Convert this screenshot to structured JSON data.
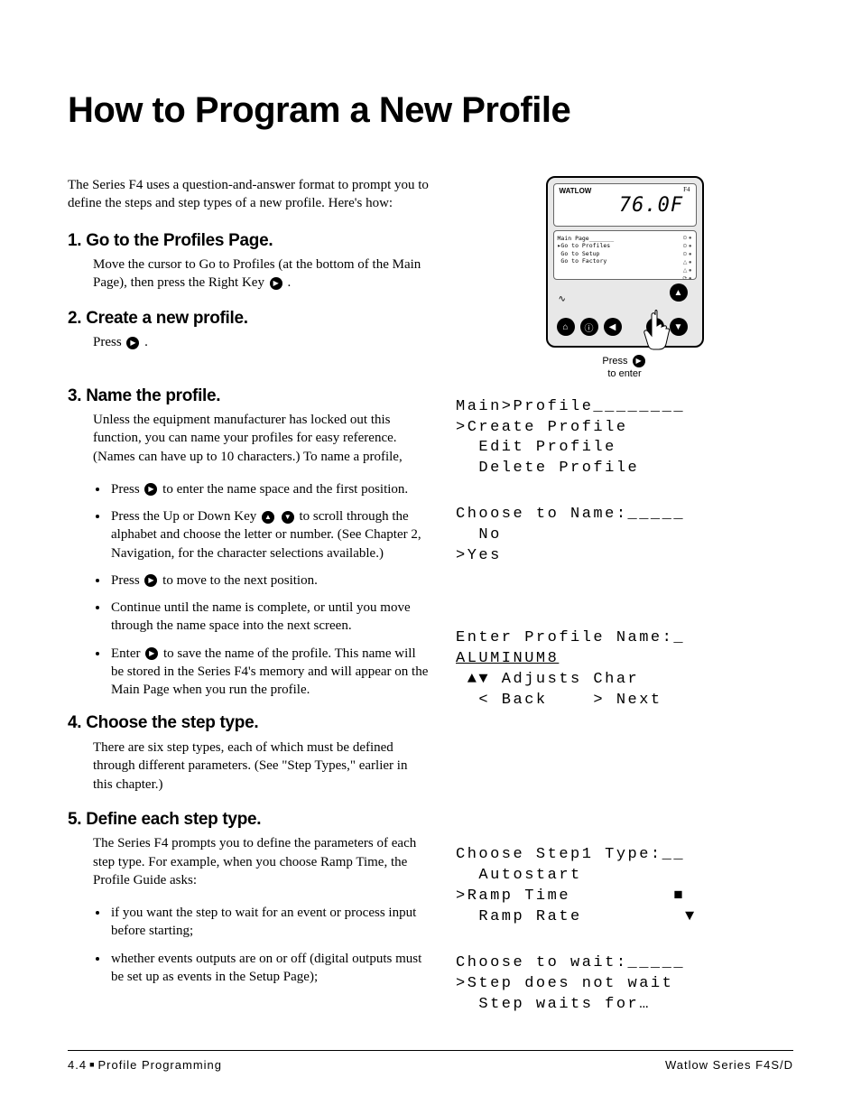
{
  "title": "How to Program a New Profile",
  "intro": "The Series F4 uses a question-and-answer format to prompt you to define the steps and step types of a new profile. Here's how:",
  "sections": [
    {
      "heading": "1. Go to the Profiles Page.",
      "body": "Move the cursor to Go to Profiles (at the bottom of the Main Page), then press the Right Key",
      "body_suffix": "."
    },
    {
      "heading": "2. Create a new profile.",
      "body": "Press",
      "body_suffix": "."
    },
    {
      "heading": "3. Name the profile.",
      "body": "Unless the equipment manufacturer has locked out this function, you can name your profiles for easy reference. (Names can have up to 10 characters.) To name a profile,",
      "bullets": [
        {
          "pre": "Press ",
          "icon": "▶",
          "post": " to enter the name space and the first position."
        },
        {
          "pre": "Press the Up or Down Key ",
          "icon": "▲",
          "icon2": "▼",
          "post": " to scroll through the alphabet and choose the letter or number. (See Chapter 2, Navigation, for the character selections available.)"
        },
        {
          "pre": "Press ",
          "icon": "▶",
          "post": " to move to the next position."
        },
        {
          "pre": "",
          "post": "Continue until the name is complete, or until you move through the name space into the next screen."
        },
        {
          "pre": "Enter ",
          "icon": "▶",
          "post": " to save the name of the profile. This name will be stored in the Series F4's memory and will appear on the Main Page when you run the profile."
        }
      ]
    },
    {
      "heading": "4. Choose the step type.",
      "body": "There are six step types, each of which must be defined through different parameters. (See \"Step Types,\" earlier in this chapter.)"
    },
    {
      "heading": "5. Define each step type.",
      "body": "The Series F4 prompts you to define the parameters of each step type. For example, when you choose Ramp Time, the Profile Guide asks:",
      "bullets2": [
        "if you want the step to wait for an event or process input before starting;",
        "whether events outputs are on or off (digital outputs must be set up as events in the Setup Page);"
      ]
    }
  ],
  "device": {
    "brand": "WATLOW",
    "model": "F4",
    "temp": "76.0F",
    "menu": "Main Page_______\n▸Go to Profiles\n Go to Setup\n Go to Factory",
    "caption_l1": "Press",
    "caption_l2": "to enter"
  },
  "lcd_screens": {
    "s1": "Main>Profile________\n>Create Profile\n  Edit Profile\n  Delete Profile",
    "s2": "Choose to Name:_____\n  No\n>Yes",
    "s3_l1": "Enter Profile Name:_",
    "s3_l2": "ALUMINUM8",
    "s3_l3": " ▲▼ Adjusts Char",
    "s3_l4": "  < Back    > Next",
    "s4": "Choose Step1 Type:__\n  Autostart\n>Ramp Time         ■\n  Ramp Rate         ▼",
    "s5": "Choose to wait:_____\n>Step does not wait\n  Step waits for…"
  },
  "footer": {
    "left_num": "4.4",
    "left_text": "Profile Programming",
    "right": "Watlow Series F4S/D"
  }
}
